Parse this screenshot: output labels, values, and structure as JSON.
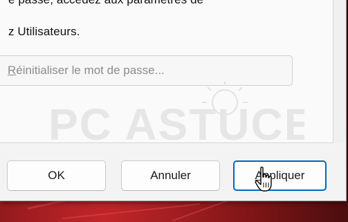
{
  "dialog": {
    "text_line1": "e passe, accédez aux paramètres de",
    "text_line2": "z Utilisateurs.",
    "reset_button": {
      "mnemonic": "R",
      "rest": "éinitialiser le mot de passe..."
    },
    "watermark": {
      "logo_text": "PC ASTUCES"
    },
    "buttons": {
      "ok": "OK",
      "cancel": "Annuler",
      "apply": {
        "mnemonic": "Ap",
        "rest": "pliquer"
      }
    }
  },
  "colors": {
    "dialog_bg": "#f3f3f3",
    "accent": "#0067c0",
    "wallpaper": "#7b1416"
  },
  "icons": {
    "cursor": "hand-pointer-icon"
  }
}
